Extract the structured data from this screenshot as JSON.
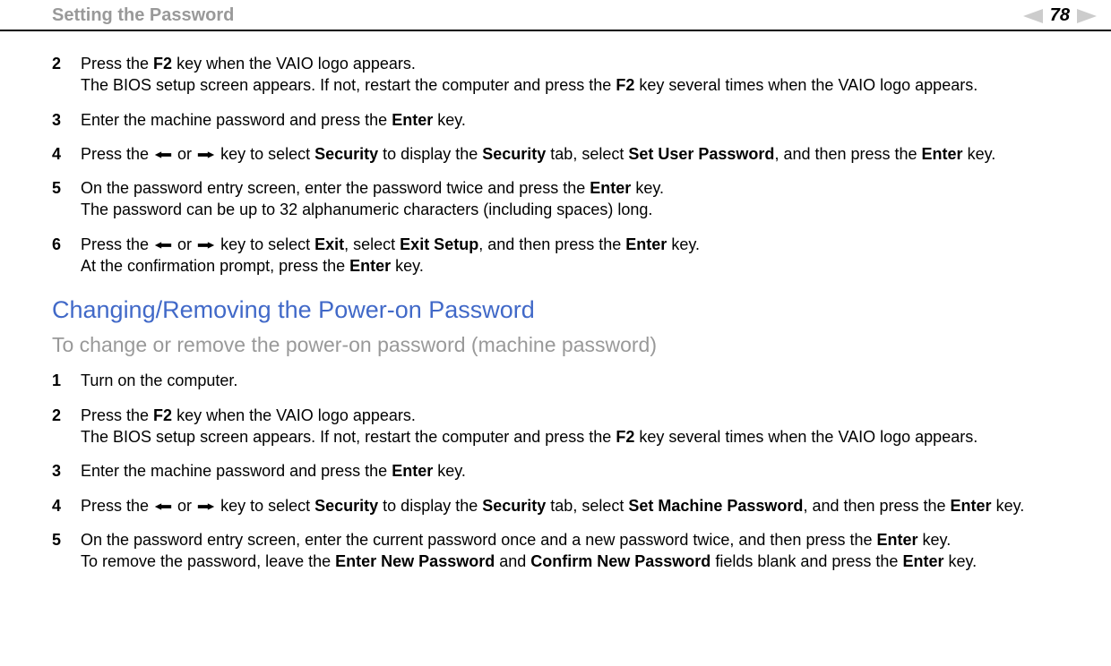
{
  "header": {
    "title": "Setting the Password",
    "page": "78"
  },
  "stepsA": [
    {
      "num": "2",
      "lines": [
        [
          {
            "t": "Press the "
          },
          {
            "b": true,
            "t": "F2"
          },
          {
            "t": " key when the VAIO logo appears."
          }
        ],
        [
          {
            "t": "The BIOS setup screen appears. If not, restart the computer and press the "
          },
          {
            "b": true,
            "t": "F2"
          },
          {
            "t": " key several times when the VAIO logo appears."
          }
        ]
      ]
    },
    {
      "num": "3",
      "lines": [
        [
          {
            "t": "Enter the machine password and press the "
          },
          {
            "b": true,
            "t": "Enter"
          },
          {
            "t": " key."
          }
        ]
      ]
    },
    {
      "num": "4",
      "lines": [
        [
          {
            "t": "Press the "
          },
          {
            "arrow": "l"
          },
          {
            "t": " or "
          },
          {
            "arrow": "r"
          },
          {
            "t": " key to select "
          },
          {
            "b": true,
            "t": "Security"
          },
          {
            "t": " to display the "
          },
          {
            "b": true,
            "t": "Security"
          },
          {
            "t": " tab, select "
          },
          {
            "b": true,
            "t": "Set User Password"
          },
          {
            "t": ", and then press the "
          },
          {
            "b": true,
            "t": "Enter"
          },
          {
            "t": " key."
          }
        ]
      ]
    },
    {
      "num": "5",
      "lines": [
        [
          {
            "t": "On the password entry screen, enter the password twice and press the "
          },
          {
            "b": true,
            "t": "Enter"
          },
          {
            "t": " key."
          }
        ],
        [
          {
            "t": "The password can be up to 32 alphanumeric characters (including spaces) long."
          }
        ]
      ]
    },
    {
      "num": "6",
      "lines": [
        [
          {
            "t": "Press the "
          },
          {
            "arrow": "l"
          },
          {
            "t": " or "
          },
          {
            "arrow": "r"
          },
          {
            "t": " key to select "
          },
          {
            "b": true,
            "t": "Exit"
          },
          {
            "t": ", select "
          },
          {
            "b": true,
            "t": "Exit Setup"
          },
          {
            "t": ", and then press the "
          },
          {
            "b": true,
            "t": "Enter"
          },
          {
            "t": " key."
          }
        ],
        [
          {
            "t": "At the confirmation prompt, press the "
          },
          {
            "b": true,
            "t": "Enter"
          },
          {
            "t": " key."
          }
        ]
      ]
    }
  ],
  "section": "Changing/Removing the Power-on Password",
  "subtitle": "To change or remove the power-on password (machine password)",
  "stepsB": [
    {
      "num": "1",
      "lines": [
        [
          {
            "t": "Turn on the computer."
          }
        ]
      ]
    },
    {
      "num": "2",
      "lines": [
        [
          {
            "t": "Press the "
          },
          {
            "b": true,
            "t": "F2"
          },
          {
            "t": " key when the VAIO logo appears."
          }
        ],
        [
          {
            "t": "The BIOS setup screen appears. If not, restart the computer and press the "
          },
          {
            "b": true,
            "t": "F2"
          },
          {
            "t": " key several times when the VAIO logo appears."
          }
        ]
      ]
    },
    {
      "num": "3",
      "lines": [
        [
          {
            "t": "Enter the machine password and press the "
          },
          {
            "b": true,
            "t": "Enter"
          },
          {
            "t": " key."
          }
        ]
      ]
    },
    {
      "num": "4",
      "lines": [
        [
          {
            "t": "Press the "
          },
          {
            "arrow": "l"
          },
          {
            "t": " or "
          },
          {
            "arrow": "r"
          },
          {
            "t": " key to select "
          },
          {
            "b": true,
            "t": "Security"
          },
          {
            "t": " to display the "
          },
          {
            "b": true,
            "t": "Security"
          },
          {
            "t": " tab, select "
          },
          {
            "b": true,
            "t": "Set Machine Password"
          },
          {
            "t": ", and then press the "
          },
          {
            "b": true,
            "t": "Enter"
          },
          {
            "t": " key."
          }
        ]
      ]
    },
    {
      "num": "5",
      "lines": [
        [
          {
            "t": "On the password entry screen, enter the current password once and a new password twice, and then press the "
          },
          {
            "b": true,
            "t": "Enter"
          },
          {
            "t": " key."
          }
        ],
        [
          {
            "t": "To remove the password, leave the "
          },
          {
            "b": true,
            "t": "Enter New Password"
          },
          {
            "t": " and "
          },
          {
            "b": true,
            "t": "Confirm New Password"
          },
          {
            "t": " fields blank and press the "
          },
          {
            "b": true,
            "t": "Enter"
          },
          {
            "t": " key."
          }
        ]
      ]
    }
  ]
}
